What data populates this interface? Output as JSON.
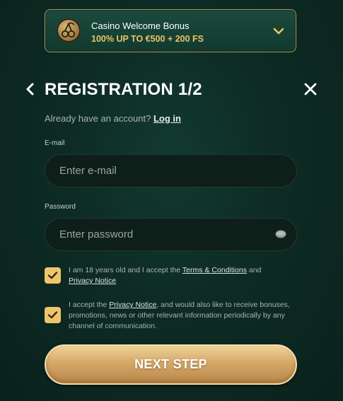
{
  "bonus": {
    "title": "Casino Welcome Bonus",
    "offer": "100% UP TO €500 + 200 FS",
    "icon": "cherry-icon",
    "accent": "#e9c467"
  },
  "header": {
    "title": "REGISTRATION 1/2",
    "back_icon": "chevron-left-icon",
    "close_icon": "close-icon"
  },
  "login_prompt": {
    "text": "Already have an account?",
    "link": "Log in"
  },
  "email": {
    "label": "E-mail",
    "placeholder": "Enter e-mail",
    "value": ""
  },
  "password": {
    "label": "Password",
    "placeholder": "Enter password",
    "value": "",
    "toggle_icon": "eye-icon"
  },
  "consents": [
    {
      "checked": true,
      "text_before": "I am 18 years old and I accept the ",
      "link1": "Terms & Conditions",
      "text_mid": " and",
      "link2": "Privacy Notice"
    },
    {
      "checked": true,
      "text_before": "I accept the ",
      "link1": "Privacy Notice",
      "text_after": ", and would also like to receive bonuses, promotions, news or other relevant information periodically by any channel of communication."
    }
  ],
  "next_button": "NEXT STEP",
  "colors": {
    "gold": "#edc66c",
    "background": "#0d2b24"
  }
}
